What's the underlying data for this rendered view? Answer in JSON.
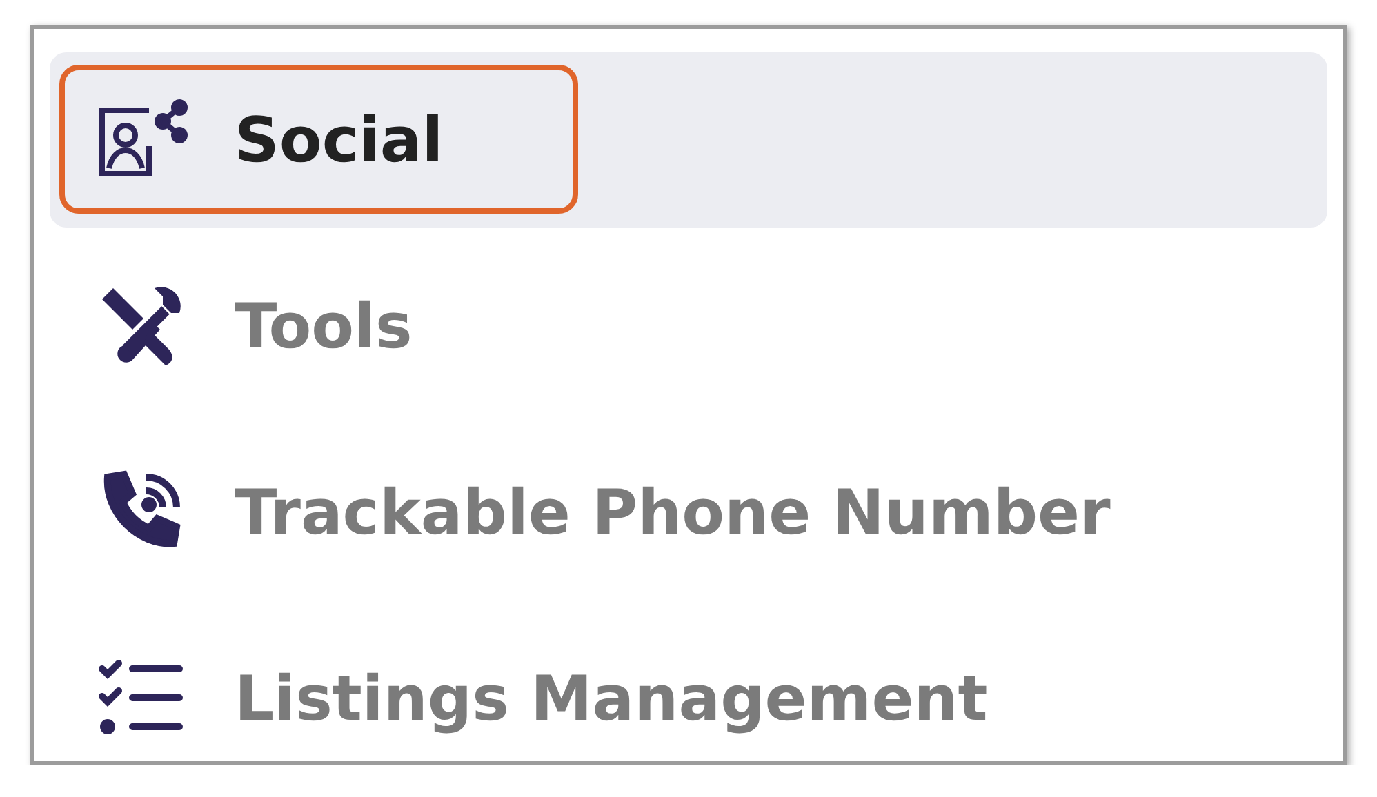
{
  "menu": {
    "items": [
      {
        "label": "Social",
        "selected": true,
        "highlighted": true
      },
      {
        "label": "Tools",
        "selected": false,
        "highlighted": false
      },
      {
        "label": "Trackable Phone Number",
        "selected": false,
        "highlighted": false
      },
      {
        "label": "Listings Management",
        "selected": false,
        "highlighted": false
      }
    ]
  }
}
